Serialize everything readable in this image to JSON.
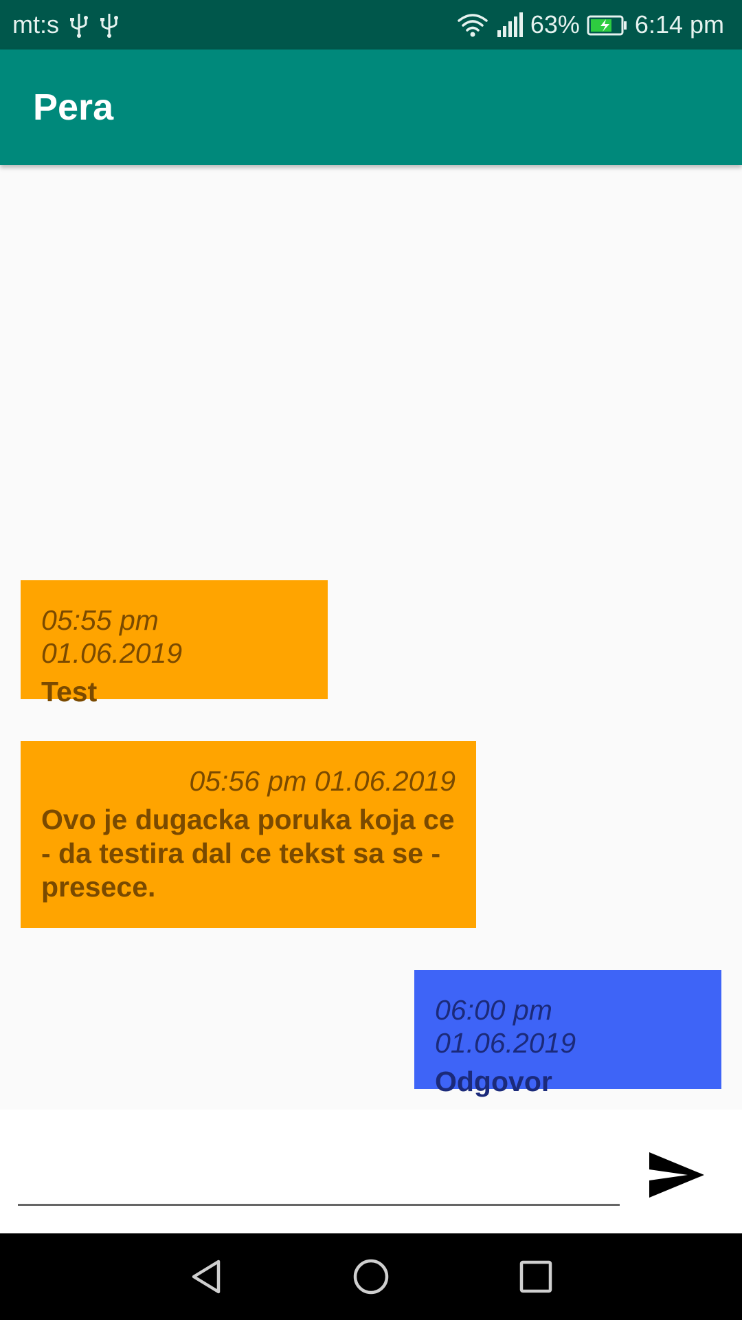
{
  "status_bar": {
    "carrier": "mt:s",
    "battery": "63%",
    "time": "6:14 pm",
    "icons": [
      "usb-icon",
      "usb-icon",
      "wifi-icon",
      "signal-icon",
      "battery-charging-icon"
    ],
    "battery_color": "#2ecc40"
  },
  "app_bar": {
    "title": "Pera",
    "color": "#00897b"
  },
  "messages": [
    {
      "direction": "incoming",
      "timestamp": "05:55 pm 01.06.2019",
      "text": "Test",
      "color": "#ffa400"
    },
    {
      "direction": "incoming",
      "timestamp": "05:56 pm 01.06.2019",
      "text": "Ovo je dugacka poruka koja ce - da testira dal ce tekst sa se - presece.",
      "color": "#ffa400"
    },
    {
      "direction": "outgoing",
      "timestamp": "06:00 pm 01.06.2019",
      "text": "Odgovor",
      "color": "#3e64f7"
    }
  ],
  "composer": {
    "value": "",
    "send_icon": "send-icon"
  },
  "nav_bar": {
    "icons": [
      "back-icon",
      "home-icon",
      "recents-icon"
    ]
  }
}
